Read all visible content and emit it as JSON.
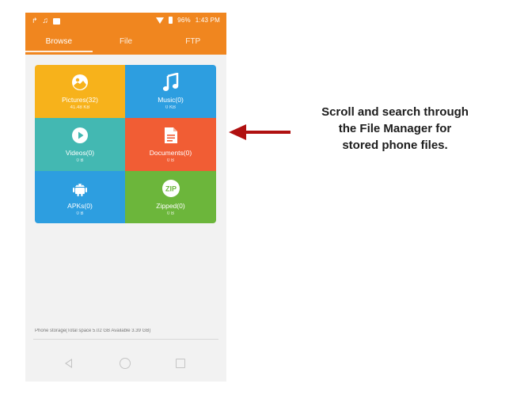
{
  "statusbar": {
    "left_icons": [
      "notification-icon",
      "music-note-icon",
      "image-icon"
    ],
    "battery_text": "96%",
    "time": "1:43 PM"
  },
  "tabs": [
    {
      "label": "Browse",
      "active": true
    },
    {
      "label": "File",
      "active": false
    },
    {
      "label": "FTP",
      "active": false
    }
  ],
  "categories": [
    {
      "key": "pictures",
      "label": "Pictures(32)",
      "size": "41.48 KB",
      "color": "#f7b21b",
      "icon": "pictures-icon"
    },
    {
      "key": "music",
      "label": "Music(0)",
      "size": "0 KB",
      "color": "#2d9ee0",
      "icon": "music-icon"
    },
    {
      "key": "videos",
      "label": "Videos(0)",
      "size": "0 B",
      "color": "#43b8b2",
      "icon": "play-icon"
    },
    {
      "key": "documents",
      "label": "Documents(0)",
      "size": "0 B",
      "color": "#f15d34",
      "icon": "document-icon"
    },
    {
      "key": "apks",
      "label": "APKs(0)",
      "size": "0 B",
      "color": "#2d9ee0",
      "icon": "android-icon"
    },
    {
      "key": "zipped",
      "label": "Zipped(0)",
      "size": "0 B",
      "color": "#6cb63b",
      "icon": "zip-icon"
    }
  ],
  "storage": {
    "text": "Phone storage(Total space 5.02 GB Available 3.39 GB)"
  },
  "navbar": {
    "icons": [
      "back-icon",
      "home-icon",
      "recent-apps-icon"
    ]
  },
  "annotation": {
    "text_line1": "Scroll and search through",
    "text_line2": "the File Manager for",
    "text_line3": "stored phone files.",
    "arrow_color": "#b01010"
  },
  "colors": {
    "appbar": "#f0861f",
    "phone_background": "#f2f2f2"
  }
}
